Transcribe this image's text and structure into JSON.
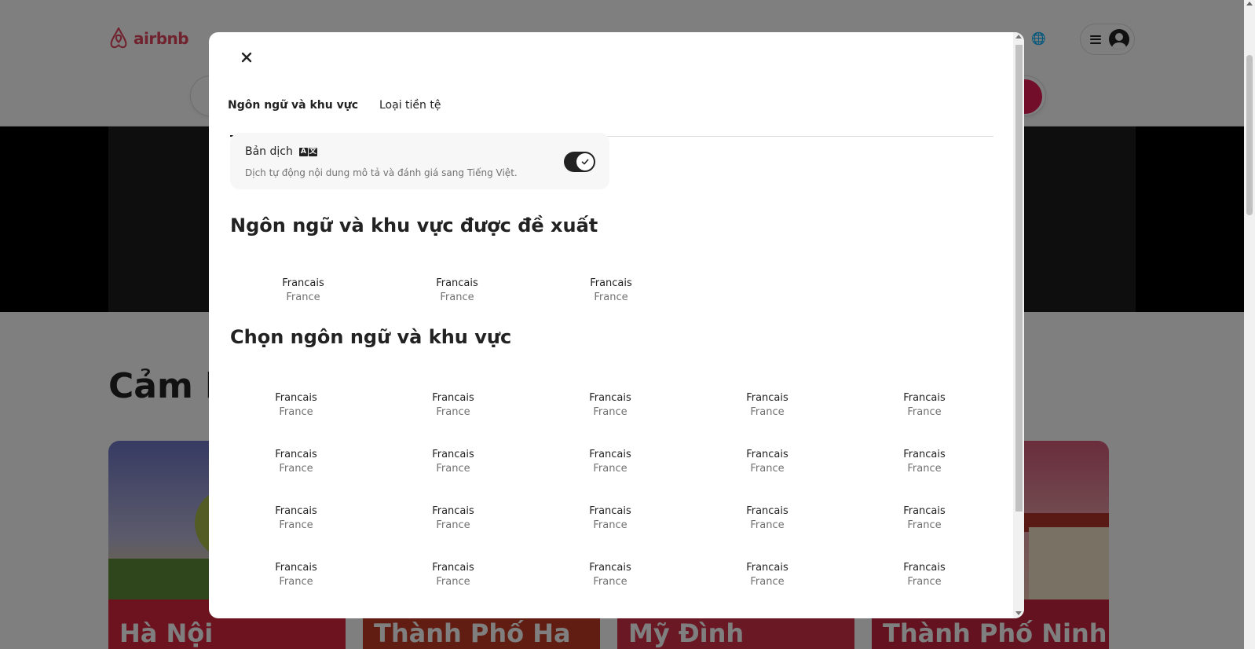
{
  "app": {
    "logo_text": "airbnb",
    "inspiration_title": "Cảm h",
    "cards": [
      "Hà Nội",
      "Thành Phố Ha",
      "Mỹ Đình",
      "Thành Phố Ninh"
    ]
  },
  "modal": {
    "tabs": [
      {
        "label": "Ngôn ngữ và khu vực",
        "active": true
      },
      {
        "label": "Loại tiền tệ",
        "active": false
      }
    ],
    "translation": {
      "title": "Bản dịch",
      "description": "Dịch tự động nội dung mô tả và đánh giá sang Tiếng Việt.",
      "enabled": true
    },
    "suggested_title": "Ngôn ngữ và khu vực được đề xuất",
    "suggested": [
      {
        "language": "Francais",
        "region": "France"
      },
      {
        "language": "Francais",
        "region": "France"
      },
      {
        "language": "Francais",
        "region": "France"
      }
    ],
    "choose_title": "Chọn ngôn ngữ và khu vực",
    "choose": [
      {
        "language": "Francais",
        "region": "France"
      },
      {
        "language": "Francais",
        "region": "France"
      },
      {
        "language": "Francais",
        "region": "France"
      },
      {
        "language": "Francais",
        "region": "France"
      },
      {
        "language": "Francais",
        "region": "France"
      },
      {
        "language": "Francais",
        "region": "France"
      },
      {
        "language": "Francais",
        "region": "France"
      },
      {
        "language": "Francais",
        "region": "France"
      },
      {
        "language": "Francais",
        "region": "France"
      },
      {
        "language": "Francais",
        "region": "France"
      },
      {
        "language": "Francais",
        "region": "France"
      },
      {
        "language": "Francais",
        "region": "France"
      },
      {
        "language": "Francais",
        "region": "France"
      },
      {
        "language": "Francais",
        "region": "France"
      },
      {
        "language": "Francais",
        "region": "France"
      },
      {
        "language": "Francais",
        "region": "France"
      },
      {
        "language": "Francais",
        "region": "France"
      },
      {
        "language": "Francais",
        "region": "France"
      },
      {
        "language": "Francais",
        "region": "France"
      },
      {
        "language": "Francais",
        "region": "France"
      }
    ]
  },
  "icons": {
    "close": "close-icon",
    "translate": "translate-icon",
    "toggle_check": "check-icon",
    "globe": "globe-icon",
    "menu": "hamburger-icon",
    "avatar": "user-avatar-icon"
  },
  "colors": {
    "brand": "#e0465c",
    "search_button": "#e51d53",
    "text": "#222222",
    "secondary_text": "#717171"
  }
}
